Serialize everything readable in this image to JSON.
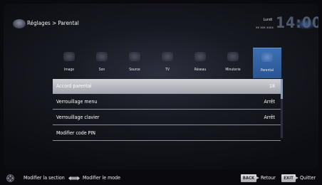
{
  "header": {
    "breadcrumb": "Réglages > Parental",
    "day": "Lundi",
    "date": "xx xxx xxxx",
    "clock": "14:00"
  },
  "categories": [
    {
      "label": "Image",
      "icon": "image-icon",
      "active": false
    },
    {
      "label": "Son",
      "icon": "sound-icon",
      "active": false
    },
    {
      "label": "Source",
      "icon": "source-icon",
      "active": false
    },
    {
      "label": "TV",
      "icon": "tv-icon",
      "active": false
    },
    {
      "label": "Réseau",
      "icon": "network-icon",
      "active": false
    },
    {
      "label": "Minuterie",
      "icon": "timer-icon",
      "active": false
    },
    {
      "label": "Parental",
      "icon": "parental-icon",
      "active": true
    }
  ],
  "menu": {
    "items": [
      {
        "label": "Accord parental",
        "value": "18"
      },
      {
        "label": "Verrouillage menu",
        "value": "Arrêt"
      },
      {
        "label": "Verrouillage clavier",
        "value": "Arrêt"
      },
      {
        "label": "Modifier code PIN",
        "value": ""
      }
    ]
  },
  "footer": {
    "modify_section": "Modifier la section",
    "modify_mode": "Modifier le mode",
    "back_key": "BACK",
    "back_label": "Retour",
    "exit_key": "EXIT",
    "exit_label": "Quitter"
  },
  "colors": {
    "accent": "#3b6fb5",
    "selection": "#c4c4cc",
    "background": "#0a0a0e"
  }
}
